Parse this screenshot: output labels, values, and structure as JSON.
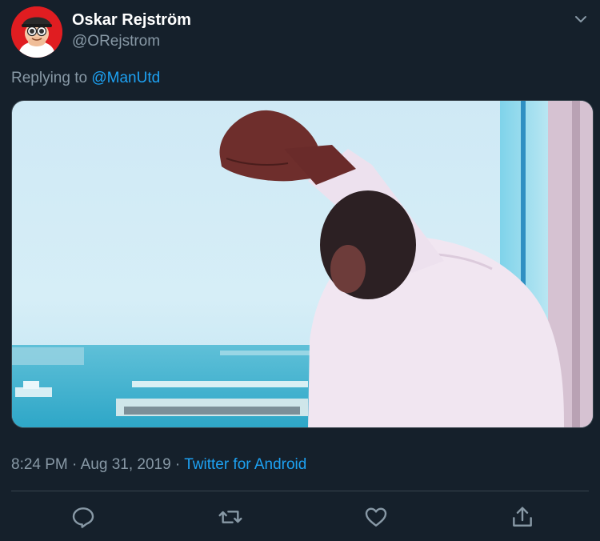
{
  "tweet": {
    "author": {
      "name": "Oskar Rejström",
      "handle": "@ORejstrom",
      "avatar_icon": "cartoon-avatar-icon"
    },
    "reply": {
      "prefix": "Replying to ",
      "mention": "@ManUtd"
    },
    "media": {
      "type": "video-still",
      "description_icon": "video-thumbnail"
    },
    "meta": {
      "time": "8:24 PM",
      "separator": " · ",
      "date": "Aug 31, 2019",
      "source": "Twitter for Android"
    },
    "actions": [
      {
        "name": "reply",
        "icon": "reply-icon"
      },
      {
        "name": "retweet",
        "icon": "retweet-icon"
      },
      {
        "name": "like",
        "icon": "heart-icon"
      },
      {
        "name": "share",
        "icon": "share-icon"
      }
    ]
  },
  "colors": {
    "background": "#15202b",
    "primary_text": "#ffffff",
    "secondary_text": "#8899a6",
    "accent": "#1da1f2",
    "divider": "#38444d"
  }
}
